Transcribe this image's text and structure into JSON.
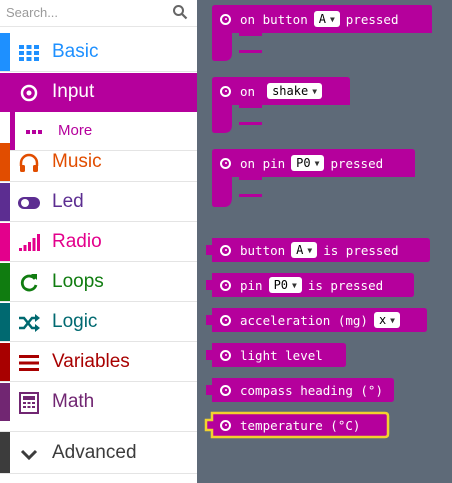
{
  "search": {
    "placeholder": "Search..."
  },
  "categories": [
    {
      "label": "Basic",
      "color": "#1e90ff",
      "icon": "grid-icon",
      "text_color": "#1e90ff"
    },
    {
      "label": "Input",
      "color": "#b5009c",
      "icon": "target-icon",
      "text_color": "#ffffff"
    },
    {
      "label": "More",
      "color": "#b5009c",
      "icon": "more-dots-icon",
      "text_color": "#b5009c"
    },
    {
      "label": "Music",
      "color": "#e14d00",
      "icon": "headphones-icon",
      "text_color": "#e14d00"
    },
    {
      "label": "Led",
      "color": "#5c2d91",
      "icon": "toggle-icon",
      "text_color": "#5c2d91"
    },
    {
      "label": "Radio",
      "color": "#e3008c",
      "icon": "signal-bars-icon",
      "text_color": "#e3008c"
    },
    {
      "label": "Loops",
      "color": "#107c10",
      "icon": "refresh-icon",
      "text_color": "#107c10"
    },
    {
      "label": "Logic",
      "color": "#006970",
      "icon": "shuffle-icon",
      "text_color": "#006970"
    },
    {
      "label": "Variables",
      "color": "#a80000",
      "icon": "list-lines-icon",
      "text_color": "#a80000"
    },
    {
      "label": "Math",
      "color": "#712672",
      "icon": "calculator-icon",
      "text_color": "#712672"
    },
    {
      "label": "Advanced",
      "color": "#3c3c3c",
      "icon": "chevron-down-icon",
      "text_color": "#3c3c3c"
    }
  ],
  "blocks": {
    "on_button": {
      "prefix": "on button",
      "value": "A",
      "suffix": "pressed"
    },
    "on_shake": {
      "prefix": "on",
      "value": "shake"
    },
    "on_pin": {
      "prefix": "on pin",
      "value": "P0",
      "suffix": "pressed"
    },
    "button_is_pressed": {
      "prefix": "button",
      "value": "A",
      "suffix": "is pressed"
    },
    "pin_is_pressed": {
      "prefix": "pin",
      "value": "P0",
      "suffix": "is pressed"
    },
    "acceleration": {
      "prefix": "acceleration (mg)",
      "value": "x"
    },
    "light_level": {
      "prefix": "light level"
    },
    "compass_heading": {
      "prefix": "compass heading (°)"
    },
    "temperature": {
      "prefix": "temperature (°C)"
    }
  },
  "colors": {
    "block": "#b5009c",
    "workspace": "#5e6a78",
    "highlight": "#f2d22e"
  },
  "arrow": "▼"
}
